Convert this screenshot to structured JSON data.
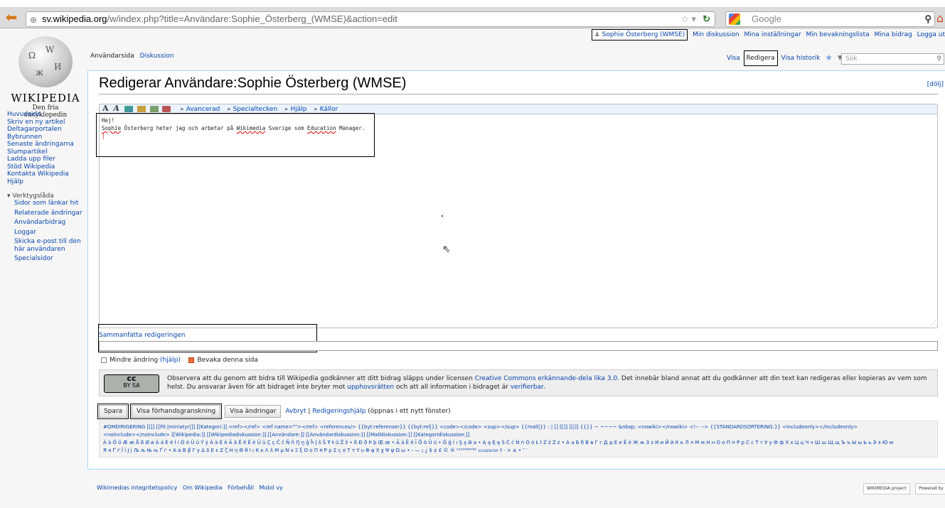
{
  "browser": {
    "url_domain": "sv.wikipedia.org",
    "url_rest": "/w/index.php?title=Användare:Sophie_Österberg_(WMSE)&action=edit",
    "search_placeholder": "Google"
  },
  "logo": {
    "name": "WIKIPEDIA",
    "tagline": "Den fria encyklopedin"
  },
  "sidebar": {
    "nav": [
      "Huvudsida",
      "Skriv en ny artikel",
      "Deltagarportalen",
      "Bybrunnen",
      "Senaste ändringarna",
      "Slumpartikel",
      "Ladda upp filer",
      "Stöd Wikipedia",
      "Kontakta Wikipedia",
      "Hjälp"
    ],
    "toolbox_title": "Verktygslåda",
    "toolbox": [
      "Sidor som länkar hit",
      "Relaterade ändringar",
      "Användarbidrag",
      "Loggar",
      "Skicka e-post till den här användaren",
      "Specialsidor"
    ]
  },
  "personal": {
    "user": "Sophie Österberg (WMSE)",
    "links": [
      "Min diskussion",
      "Mina inställningar",
      "Min bevakningslista",
      "Mina bidrag",
      "Logga ut"
    ]
  },
  "tabs": {
    "left": [
      "Användarsida",
      "Diskussion"
    ],
    "view": "Visa",
    "edit": "Redigera",
    "history": "Visa historik",
    "search_placeholder": "Sök"
  },
  "heading": {
    "title": "Redigerar Användare:Sophie Österberg (WMSE)",
    "hide": "[dölj]"
  },
  "toolbar": {
    "bold": "A",
    "italic": "A",
    "groups": [
      "Avancerad",
      "Specialtecken",
      "Hjälp",
      "Källor"
    ]
  },
  "editor": {
    "line1": "Hej!",
    "line2": "",
    "line3_a": "Sophie",
    "line3_b": " Österberg heter jag och arbetar på ",
    "line3_c": "Wikimedia",
    "line3_d": " Sverige som ",
    "line3_e": "Education",
    "line3_f": " Manager."
  },
  "summary": {
    "label": "Sammanfatta redigeringen",
    "value": ""
  },
  "checkboxes": {
    "minor_label": "Mindre ändring",
    "minor_help": "(hjälp)",
    "watch_label": "Bevaka denna sida",
    "minor_checked": false,
    "watch_checked": true
  },
  "license": {
    "badge_top": "cc",
    "badge_bottom": "BY   SA",
    "text1": "Observera att du genom att bidra till Wikipedia godkänner att ditt bidrag släpps under licensen ",
    "link1": "Creative Commons erkännande-dela lika 3.0",
    "text2": ". Det innebär bland annat att du godkänner att din text kan redigeras eller kopieras av vem som helst. Du ansvarar även för att bidraget inte bryter mot ",
    "link2": "upphovsrätten",
    "text3": " och att all information i bidraget är ",
    "link3": "verifierbar",
    "text4": "."
  },
  "buttons": {
    "save": "Spara",
    "preview": "Visa förhandsgranskning",
    "diff": "Visa ändringar",
    "cancel": "Avbryt",
    "sep": " | ",
    "help": "Redigeringshjälp",
    "help_note": " (öppnas i ett nytt fönster)"
  },
  "charinsert": {
    "line1": "#OMDIRIGERING [[]] [[Fil:|miniatyr|]] [[Kategori:]] <ref></ref> <ref name=\"\"></ref> <references/> {{byt:referenser}} {{byt:rel|}} <code></code> <sup></sup> {{mall|}} : | [] [[]] [[|]] {{}} ~ ~~~~ &nbsp; <nowiki></nowiki> <!-- --> {{STANDARDSORTERING:}} <includeonly></includeonly>",
    "line2": "<noinclude></noinclude> [[Wikipedia:]] [[Wikipediadiskussion:]] [[Användare:]] [[Användardiskussion:]] [[Malldiskussion:]] [[Kategoridiskussion:]]",
    "line3": "Ä ä Ö ö Æ æ Å ß Ø ø Á á É é Í í Ó ó Ú ú Ý ý À à È è Â â Ê ê Ë ë Ü ü Ç ç Ĉ ĉ Ñ ñ Ŋ ŋ ĝ ĥ ĵ ŝ Š Ŧ ŧ û Ž ž • ß Ð ð Þ þ Œ œ • Ā ā Ē ē Ī Ō ō Ū ū • Ğ ğ İ ı Ş ş Ə ə • Ą ą Ę ę Ś Ć ć Ń ń Ó ó Ł ł Ź ź Ż ż • А а Б б В в Г г Д д Е е Ё ё Ж ж З з И и Й й К к Л л М м Н н О о П п Р р С с Т т У у Ф ф Х х Ц ц Ч ч Ш ш Щ щ Ъ ъ Ы ы Ь ь Э э Ю ю",
    "line4": "Я я Ґ ґ Ї ї Ј ј Љ љ Њ њ Ґ ґ • Α α Β β Γ γ Δ δ Ε ε Ζ ζ Η η Θ θ Ι ι Κ κ Λ λ Μ μ Ν ν Ξ ξ Ο ο Π π Ρ ρ Σ ς σ Τ τ Υ υ Φ φ Χ χ Ψ ψ Ω ω • - — ¡ ¿ $ ¢ £ © ® ⁰¹²³⁴⁵⁶⁷⁸⁹ ₀₁₂₃₄₅₆₇₈₉ † · × ± • ″ ′"
  },
  "footer": {
    "links": [
      "Wikimedias integritetspolicy",
      "Om Wikipedia",
      "Förbehåll",
      "Mobil vy"
    ],
    "badge1": "WIKIMEDIA project",
    "badge2": "Powered by MediaWiki"
  },
  "colors": {
    "link": "#0645ad",
    "content_border": "#a7d7f9",
    "watch_checkbox": "#f07040"
  }
}
